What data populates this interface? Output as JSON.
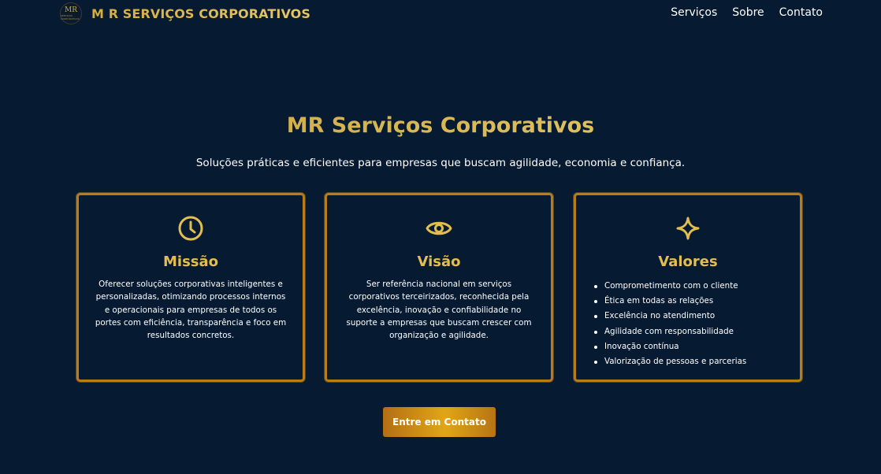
{
  "header": {
    "logo": {
      "initials": "MR",
      "tagline": "SERVIÇOS CORPORATIVOS"
    },
    "brand": "M R SERVIÇOS CORPORATIVOS",
    "nav": [
      {
        "label": "Serviços"
      },
      {
        "label": "Sobre"
      },
      {
        "label": "Contato"
      }
    ]
  },
  "hero": {
    "title": "MR Serviços Corporativos",
    "subtitle": "Soluções práticas e eficientes para empresas que buscam agilidade, economia e confiança."
  },
  "cards": [
    {
      "icon": "clock-icon",
      "title": "Missão",
      "text": "Oferecer soluções corporativas inteligentes e personalizadas, otimizando processos internos e operacionais para empresas de todos os portes com eficiência, transparência e foco em resultados concretos."
    },
    {
      "icon": "eye-icon",
      "title": "Visão",
      "text": "Ser referência nacional em serviços corporativos terceirizados, reconhecida pela excelência, inovação e confiabilidade no suporte a empresas que buscam crescer com organização e agilidade."
    },
    {
      "icon": "sparkle-icon",
      "title": "Valores",
      "items": [
        "Comprometimento com o cliente",
        "Ética em todas as relações",
        "Excelência no atendimento",
        "Agilidade com responsabilidade",
        "Inovação contínua",
        "Valorização de pessoas e parcerias"
      ]
    }
  ],
  "cta": {
    "label": "Entre em Contato"
  },
  "colors": {
    "background": "#061a32",
    "gold": "#d6b24e",
    "card_border": "#b97d17",
    "button_gradient_start": "#b46e14",
    "button_gradient_mid": "#e1a616"
  }
}
